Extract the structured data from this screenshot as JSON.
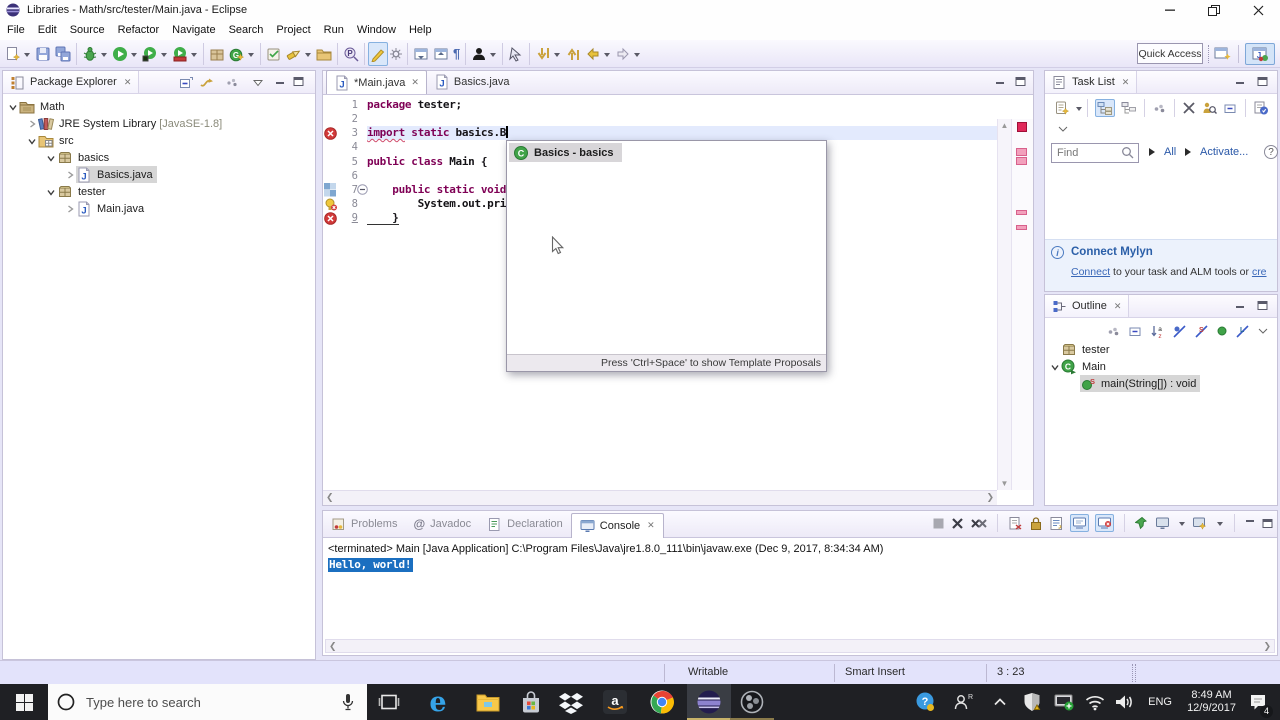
{
  "window": {
    "title": "Libraries - Math/src/tester/Main.java - Eclipse"
  },
  "menu": [
    "File",
    "Edit",
    "Source",
    "Refactor",
    "Navigate",
    "Search",
    "Project",
    "Run",
    "Window",
    "Help"
  ],
  "toolbar": {
    "quick_access": "Quick Access",
    "groups": [
      [
        "new-wizard:dd",
        "save",
        "save-all"
      ],
      [
        "debug:dd",
        "run:dd",
        "run-config:dd",
        "coverage:dd"
      ],
      [
        "new-java-project",
        "new-class:dd"
      ],
      [
        "open-task",
        "search-flashlight:dd",
        "open-folder"
      ],
      [
        "search-p"
      ],
      [
        "mark-occurrences:hl",
        "gear-small"
      ],
      [
        "next-annotation",
        "prev-annotation",
        "show-whitespace"
      ],
      [
        "user:dd"
      ],
      [
        "restore-pointer"
      ],
      [
        "last-edit:dd",
        "up-bar",
        "back-arrow:dd",
        "forward-arrow:dd"
      ]
    ]
  },
  "package_explorer": {
    "title": "Package Explorer",
    "tree": [
      {
        "label": "Math",
        "icon": "project-icon",
        "depth": 0,
        "exp": "open"
      },
      {
        "label": "JRE System Library",
        "suffix": "[JavaSE-1.8]",
        "icon": "library-icon",
        "depth": 1,
        "exp": "closed"
      },
      {
        "label": "src",
        "icon": "src-folder-icon",
        "depth": 1,
        "exp": "open"
      },
      {
        "label": "basics",
        "icon": "package-icon",
        "depth": 2,
        "exp": "open"
      },
      {
        "label": "Basics.java",
        "icon": "java-file-icon",
        "depth": 3,
        "exp": "closed",
        "selected": true
      },
      {
        "label": "tester",
        "icon": "package-icon",
        "depth": 2,
        "exp": "open"
      },
      {
        "label": "Main.java",
        "icon": "java-file-icon",
        "depth": 3,
        "exp": "closed"
      }
    ]
  },
  "editor": {
    "tabs": [
      {
        "label": "*Main.java",
        "active": true,
        "closable": true
      },
      {
        "label": "Basics.java",
        "active": false
      }
    ],
    "lines": [
      {
        "n": "1",
        "code": [
          [
            "k",
            "package"
          ],
          [
            "p",
            " tester;"
          ]
        ]
      },
      {
        "n": "2",
        "code": []
      },
      {
        "n": "3",
        "code": [
          [
            "e",
            "import"
          ],
          [
            "p",
            " "
          ],
          [
            "k",
            "static"
          ],
          [
            "p",
            " basics.B"
          ]
        ],
        "current": true,
        "caret": true,
        "marker": "error"
      },
      {
        "n": "4",
        "code": []
      },
      {
        "n": "5",
        "code": [
          [
            "k",
            "public"
          ],
          [
            "p",
            " "
          ],
          [
            "k",
            "class"
          ],
          [
            "p",
            " Main {"
          ]
        ]
      },
      {
        "n": "6",
        "code": []
      },
      {
        "n": "7",
        "code": [
          [
            "p",
            "    "
          ],
          [
            "k",
            "public"
          ],
          [
            "p",
            " "
          ],
          [
            "k",
            "static"
          ],
          [
            "p",
            " "
          ],
          [
            "k",
            "void"
          ]
        ],
        "fold": true,
        "marker": "occurrence"
      },
      {
        "n": "8",
        "code": [
          [
            "p",
            "        System.out.pri"
          ]
        ],
        "marker": "quickfix"
      },
      {
        "n": "9",
        "code": [
          [
            "b",
            "    }"
          ]
        ],
        "marker": "error",
        "ul": true
      }
    ]
  },
  "completion": {
    "items": [
      {
        "label": "Basics - basics",
        "selected": true
      }
    ],
    "hint": "Press 'Ctrl+Space' to show Template Proposals"
  },
  "task_list": {
    "title": "Task List",
    "find_placeholder": "Find",
    "all_label": "All",
    "activate_label": "Activate...",
    "mylyn": {
      "title": "Connect Mylyn",
      "link1": "Connect",
      "text": " to your task and ALM tools or ",
      "link2": "cre"
    }
  },
  "outline": {
    "title": "Outline",
    "tree": [
      {
        "label": "tester",
        "icon": "package-icon",
        "depth": 0,
        "exp": "none"
      },
      {
        "label": "Main",
        "icon": "class-run-icon",
        "depth": 0,
        "exp": "open"
      },
      {
        "label": "main(String[]) : void",
        "icon": "static-method-icon",
        "depth": 1,
        "exp": "none",
        "selected": true
      }
    ]
  },
  "console": {
    "tabs": [
      {
        "label": "Problems",
        "icon": "problems-icon"
      },
      {
        "label": "Javadoc",
        "icon": "javadoc-icon"
      },
      {
        "label": "Declaration",
        "icon": "declaration-icon"
      },
      {
        "label": "Console",
        "icon": "console-icon",
        "active": true,
        "closable": true
      }
    ],
    "header": "<terminated> Main [Java Application] C:\\Program Files\\Java\\jre1.8.0_111\\bin\\javaw.exe (Dec 9, 2017, 8:34:34 AM)",
    "output": "Hello, world!"
  },
  "status_bar": {
    "writable": "Writable",
    "insert_mode": "Smart Insert",
    "position": "3 : 23"
  },
  "taskbar": {
    "search_placeholder": "Type here to search",
    "lang": "ENG",
    "time": "8:49 AM",
    "date": "12/9/2017",
    "badge": "4"
  }
}
